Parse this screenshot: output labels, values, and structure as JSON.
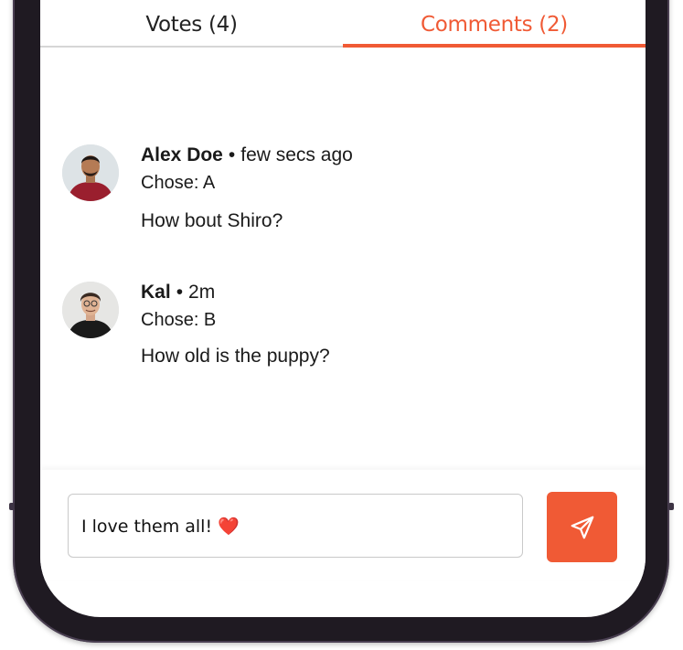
{
  "tabs": {
    "votes": "Votes (4)",
    "comments": "Comments (2)",
    "active": "comments"
  },
  "comments": [
    {
      "author": "Alex Doe",
      "time": "few secs ago",
      "chose": "Chose: A",
      "text": "How bout Shiro?"
    },
    {
      "author": "Kal",
      "time": "2m",
      "chose": "Chose: B",
      "text": "How old is the puppy?"
    }
  ],
  "composer": {
    "value": "I love them all! ❤️",
    "send_icon": "send-icon"
  },
  "colors": {
    "accent": "#f05a35",
    "text": "#1a1a1a",
    "frame": "#1f1a22"
  }
}
